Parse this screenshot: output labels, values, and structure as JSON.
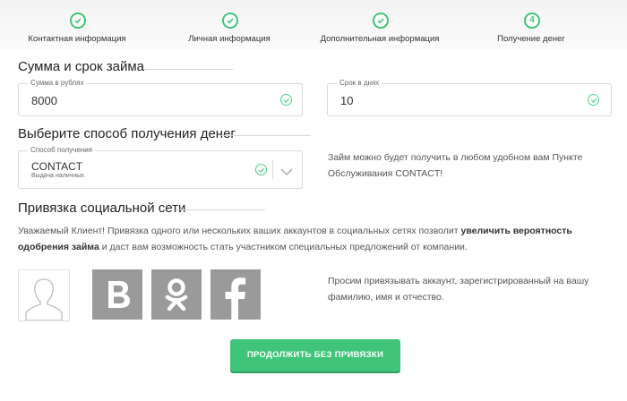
{
  "stepper": {
    "steps": [
      {
        "label": "Контактная информация",
        "state": "done"
      },
      {
        "label": "Личная информация",
        "state": "done"
      },
      {
        "label": "Дополнительная информация",
        "state": "done"
      },
      {
        "label": "Получение денег",
        "state": "current",
        "number": "4"
      }
    ]
  },
  "loan": {
    "title": "Сумма и срок займа",
    "amount": {
      "label": "Сумма в рублях",
      "value": "8000"
    },
    "term": {
      "label": "Срок в днях",
      "value": "10"
    }
  },
  "method": {
    "title": "Выберите способ получения денег",
    "select": {
      "label": "Способ получения",
      "value": "CONTACT",
      "sublabel": "Выдача наличных"
    },
    "note": "Займ можно будет получить в любом удобном вам Пункте Обслуживания CONTACT!"
  },
  "social": {
    "title": "Привязка социальной сети",
    "intro_1": "Уважаемый Клиент! Привязка одного или нескольких ваших аккаунтов в социальных сетях позволит ",
    "intro_bold": "увеличить вероятность одобрения займа",
    "intro_2": " и даст вам возможность стать участником специальных предложений от компании.",
    "networks": [
      "vk-icon",
      "odnoklassniki-icon",
      "facebook-icon"
    ],
    "note": "Просим привязывать аккаунт, зарегистрированный на вашу фамилию, имя и отчество."
  },
  "actions": {
    "continue_label": "ПРОДОЛЖИТЬ БЕЗ ПРИВЯЗКИ"
  },
  "colors": {
    "accent": "#3fc47a",
    "social_tile": "#9a9a9a"
  }
}
